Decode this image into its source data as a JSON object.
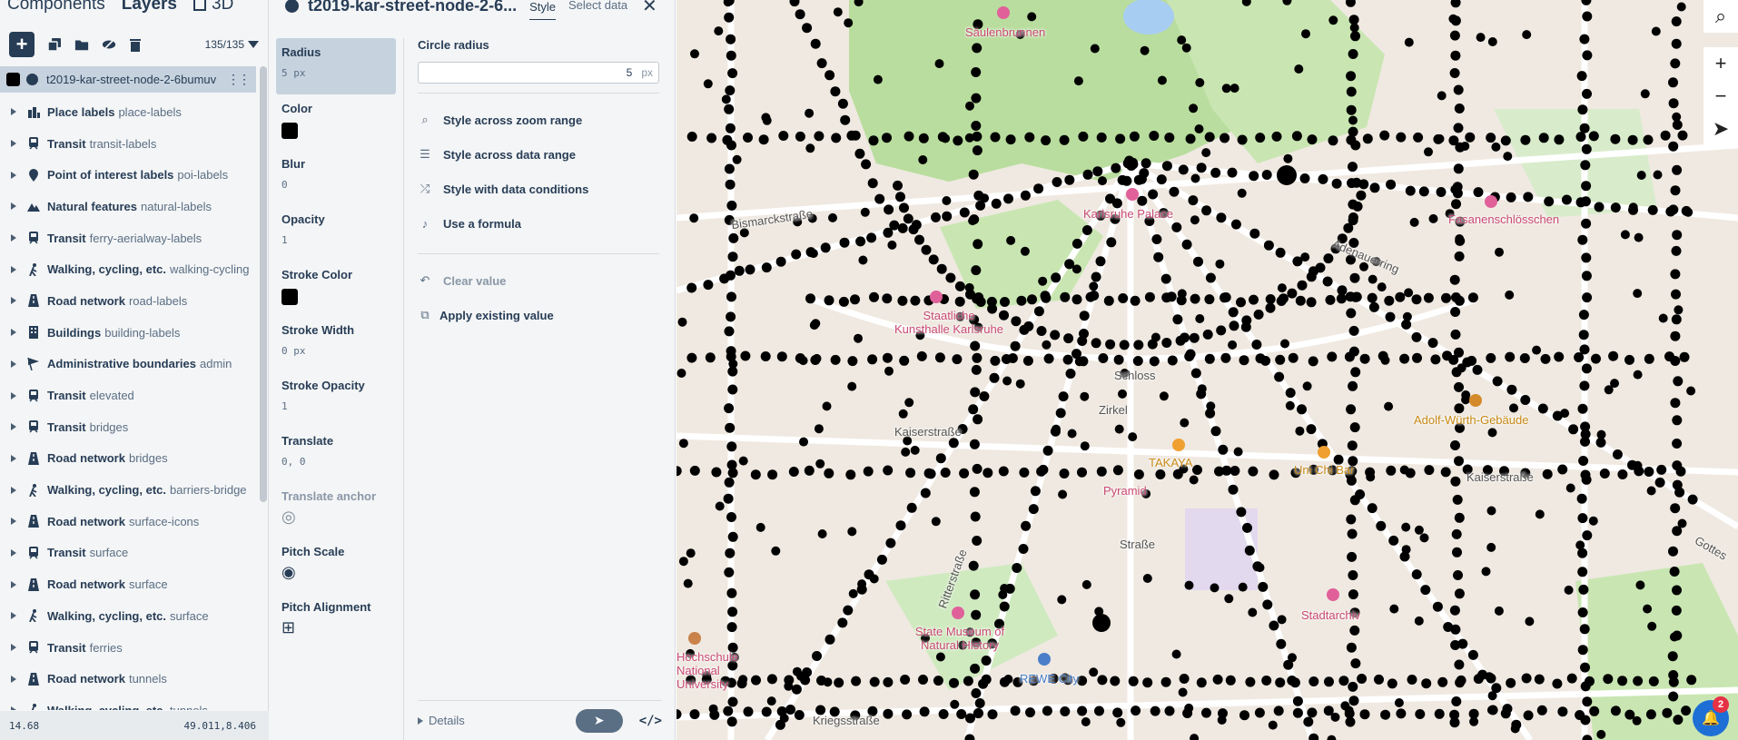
{
  "layers_panel": {
    "tabs": {
      "components": "Components",
      "layers": "Layers",
      "three_d": "3D"
    },
    "count": "135/135",
    "selected_layer": "t2019-kar-street-node-2-6bumuv",
    "items": [
      {
        "group": "Place labels",
        "id": "place-labels",
        "icon": "place-icon"
      },
      {
        "group": "Transit",
        "id": "transit-labels",
        "icon": "transit-icon"
      },
      {
        "group": "Point of interest labels",
        "id": "poi-labels",
        "icon": "poi-pin-icon"
      },
      {
        "group": "Natural features",
        "id": "natural-labels",
        "icon": "mountain-icon"
      },
      {
        "group": "Transit",
        "id": "ferry-aerialway-labels",
        "icon": "transit-icon"
      },
      {
        "group": "Walking, cycling, etc.",
        "id": "walking-cycling",
        "icon": "walking-icon"
      },
      {
        "group": "Road network",
        "id": "road-labels",
        "icon": "road-icon"
      },
      {
        "group": "Buildings",
        "id": "building-labels",
        "icon": "building-icon"
      },
      {
        "group": "Administrative boundaries",
        "id": "admin",
        "icon": "flag-icon"
      },
      {
        "group": "Transit",
        "id": "elevated",
        "icon": "transit-icon"
      },
      {
        "group": "Transit",
        "id": "bridges",
        "icon": "transit-icon"
      },
      {
        "group": "Road network",
        "id": "bridges",
        "icon": "road-icon"
      },
      {
        "group": "Walking, cycling, etc.",
        "id": "barriers-bridge",
        "icon": "walking-icon"
      },
      {
        "group": "Road network",
        "id": "surface-icons",
        "icon": "road-icon"
      },
      {
        "group": "Transit",
        "id": "surface",
        "icon": "transit-icon"
      },
      {
        "group": "Road network",
        "id": "surface",
        "icon": "road-icon"
      },
      {
        "group": "Walking, cycling, etc.",
        "id": "surface",
        "icon": "walking-icon"
      },
      {
        "group": "Transit",
        "id": "ferries",
        "icon": "transit-icon"
      },
      {
        "group": "Road network",
        "id": "tunnels",
        "icon": "road-icon"
      },
      {
        "group": "Walking, cycling, etc.",
        "id": "tunnels",
        "icon": "walking-icon"
      }
    ],
    "status": {
      "zoom": "14.68",
      "coords": "49.011,8.406"
    }
  },
  "props_panel": {
    "title": "t2019-kar-street-node-2-6...",
    "tab_style": "Style",
    "tab_select_data": "Select data",
    "properties": [
      {
        "name": "Radius",
        "value": "5 px"
      },
      {
        "name": "Color",
        "value": "#000000"
      },
      {
        "name": "Blur",
        "value": "0"
      },
      {
        "name": "Opacity",
        "value": "1"
      },
      {
        "name": "Stroke Color",
        "value": "#000000"
      },
      {
        "name": "Stroke Width",
        "value": "0 px"
      },
      {
        "name": "Stroke Opacity",
        "value": "1"
      },
      {
        "name": "Translate",
        "value": "0, 0"
      },
      {
        "name": "Translate anchor",
        "value": ""
      },
      {
        "name": "Pitch Scale",
        "value": ""
      },
      {
        "name": "Pitch Alignment",
        "value": ""
      }
    ],
    "editor": {
      "label": "Circle radius",
      "value": "5",
      "unit": "px",
      "options": [
        "Style across zoom range",
        "Style across data range",
        "Style with data conditions",
        "Use a formula"
      ],
      "clear_value": "Clear value",
      "apply_existing": "Apply existing value"
    },
    "details": "Details",
    "code_button": "</>"
  },
  "map": {
    "labels": {
      "saulenbrunnen": "Säulenbrunnen",
      "bismarckstrasse": "Bismarckstraße",
      "karlsruhe_palace": "Karlsruhe Palace",
      "kunsthalle": "Staatliche Kunsthalle Karlsruhe",
      "schloss": "Schloss",
      "kaiserstrasse_w": "Kaiserstraße",
      "kaiserstrasse_e": "Kaiserstraße",
      "takaya": "TAKAYA",
      "uni_chi_bar": "Uni Chi Bar",
      "pyramid": "Pyramid",
      "adolf_wurth": "Adolf-Würth-Gebäude",
      "fasanenschlosschen": "Fasanenschlösschen",
      "state_museum": "State Museum of Natural History",
      "rewe": "REWE City",
      "stadtarchiv": "Stadtarchiv",
      "university": "Hochschule National University",
      "kriegsstrasse": "Kriegsstraße",
      "gottesaue": "Gottes",
      "strasse": "Straße",
      "zirkel": "Zirkel",
      "ritterstrasse": "Ritterstraße",
      "adenauerring": "Adenauerring"
    },
    "notifications_count": "2",
    "node_color": "#000000",
    "park_color": "#b9dd9e"
  }
}
